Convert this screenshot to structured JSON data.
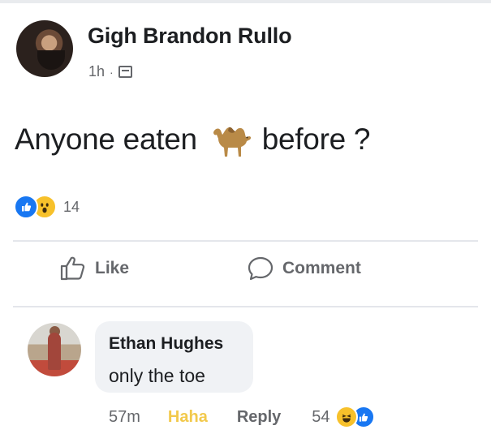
{
  "post": {
    "author": "Gigh Brandon Rullo",
    "time": "1h",
    "separator": "·",
    "text_before": "Anyone eaten",
    "emoji": "camel",
    "text_after": "before ?",
    "reaction_count": "14",
    "reactions": [
      "like",
      "wow"
    ]
  },
  "actions": {
    "like_label": "Like",
    "comment_label": "Comment"
  },
  "comment": {
    "author": "Ethan Hughes",
    "text": "only the toe",
    "time": "57m",
    "haha_label": "Haha",
    "reply_label": "Reply",
    "reaction_count": "54",
    "reactions": [
      "haha",
      "like"
    ]
  },
  "colors": {
    "facebook_blue": "#1877f2",
    "secondary_text": "#65676b",
    "haha_active": "#f2c94c",
    "bubble_bg": "#f0f2f5"
  }
}
